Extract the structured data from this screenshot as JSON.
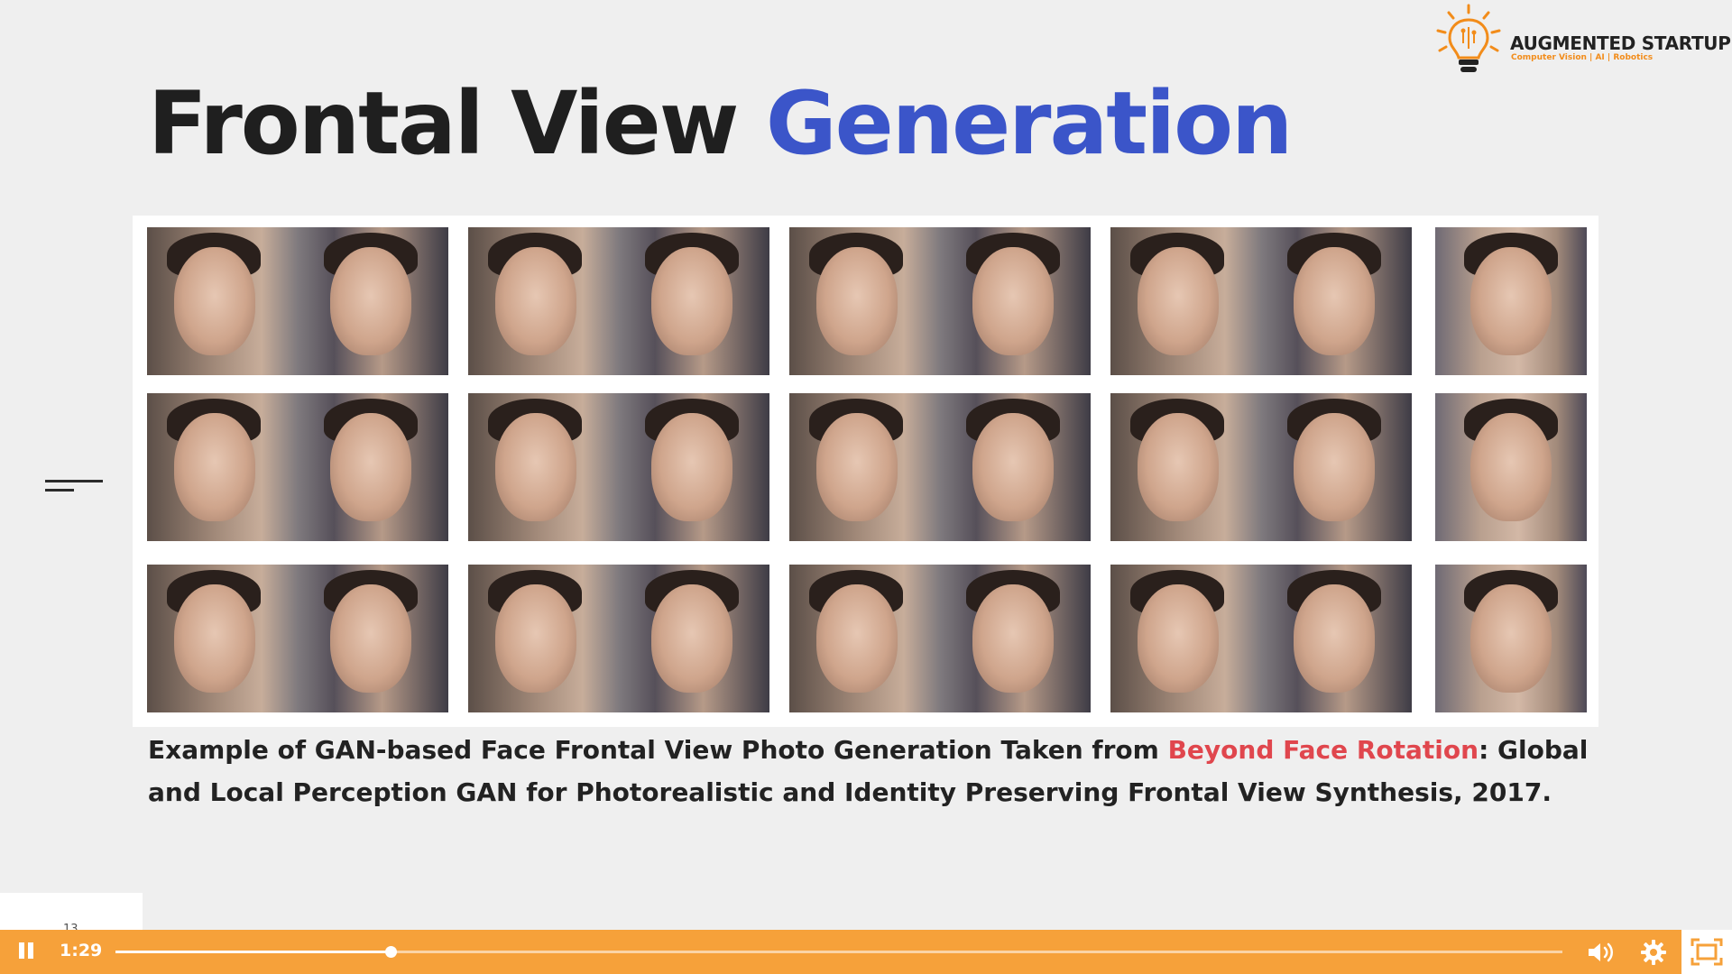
{
  "slide": {
    "title_part1": "Frontal View",
    "title_part2": "Generation",
    "caption_before_link": "Example of GAN-based Face Frontal View Photo Generation Taken from ",
    "caption_link": "Beyond Face Rotation",
    "caption_after_link": ": Global and Local Perception GAN for Photorealistic and Identity Preserving Frontal View Synthesis, 2017.",
    "title_accent_color": "#3b55c9",
    "link_color": "#e0464d"
  },
  "logo": {
    "name": "AUGMENTED STARTUPS",
    "tagline": "Computer Vision | AI | Robotics",
    "icon": "lightbulb-icon"
  },
  "player": {
    "time": "1:29",
    "progress": 0.19,
    "page_number": "13",
    "accent_color": "#f6a13a",
    "icons": [
      "pause-icon",
      "volume-icon",
      "gear-icon",
      "fullscreen-icon"
    ]
  }
}
